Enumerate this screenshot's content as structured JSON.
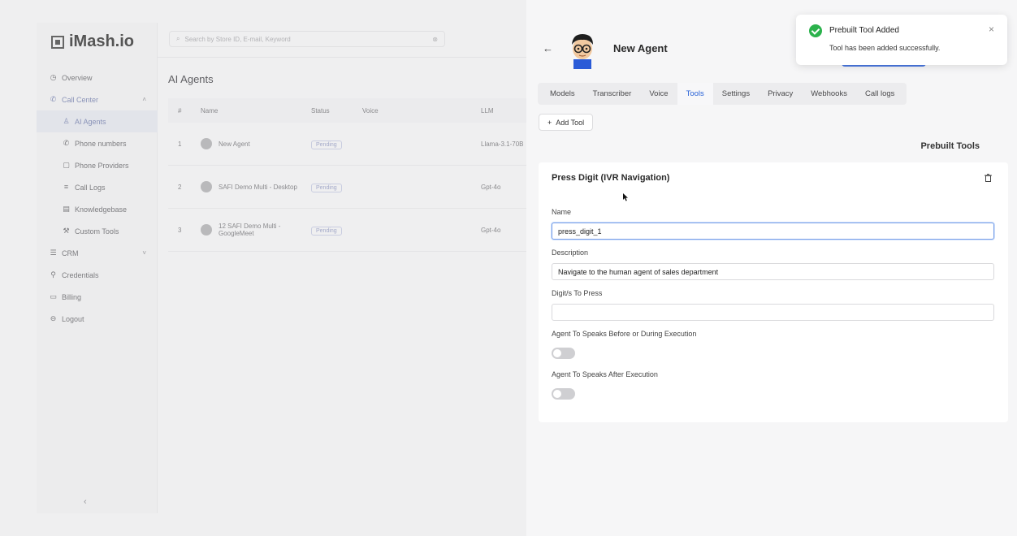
{
  "app": {
    "logo": "iMash.io",
    "search_placeholder": "Search by Store ID, E-mail, Keyword",
    "page_title": "AI Agents",
    "sidebar": [
      {
        "label": "Overview",
        "icon": "clock-icon"
      },
      {
        "label": "Call Center",
        "icon": "phone-icon"
      },
      {
        "label": "AI Agents",
        "icon": "user-icon"
      },
      {
        "label": "Phone numbers",
        "icon": "phone-icon"
      },
      {
        "label": "Phone Providers",
        "icon": "box-icon"
      },
      {
        "label": "Call Logs",
        "icon": "list-icon"
      },
      {
        "label": "Knowledgebase",
        "icon": "doc-icon"
      },
      {
        "label": "Custom Tools",
        "icon": "wrench-icon"
      },
      {
        "label": "CRM",
        "icon": "db-icon"
      },
      {
        "label": "Credentials",
        "icon": "key-icon"
      },
      {
        "label": "Billing",
        "icon": "card-icon"
      },
      {
        "label": "Logout",
        "icon": "logout-icon"
      }
    ],
    "table": {
      "headers": [
        "#",
        "Name",
        "Status",
        "Voice",
        "LLM"
      ],
      "rows": [
        {
          "num": "1",
          "name": "New Agent",
          "status": "Pending",
          "voice": "",
          "llm": "Llama-3.1-70B"
        },
        {
          "num": "2",
          "name": "SAFI Demo Multi - Desktop",
          "status": "Pending",
          "voice": "",
          "llm": "Gpt-4o"
        },
        {
          "num": "3",
          "name": "12 SAFI Demo Multi - GoogleMeet",
          "status": "Pending",
          "voice": "",
          "llm": "Gpt-4o"
        }
      ]
    }
  },
  "drawer": {
    "agent_name": "New Agent",
    "tabs": [
      "Models",
      "Transcriber",
      "Voice",
      "Tools",
      "Settings",
      "Privacy",
      "Webhooks",
      "Call logs"
    ],
    "active_tab": "Tools",
    "add_tool_label": "Add Tool",
    "prebuilt_label": "Prebuilt Tools",
    "card": {
      "title": "Press Digit (IVR Navigation)",
      "name_label": "Name",
      "name_value": "press_digit_1",
      "description_label": "Description",
      "description_value": "Navigate to the human agent of sales department",
      "digits_label": "Digit/s To Press",
      "digits_value": "",
      "speak_before_label": "Agent To Speaks Before or During Execution",
      "speak_before_on": false,
      "speak_after_label": "Agent To Speaks After Execution",
      "speak_after_on": false
    }
  },
  "toast": {
    "title": "Prebuilt Tool Added",
    "message": "Tool has been added successfully."
  },
  "colors": {
    "accent": "#2a63d7",
    "success": "#2bb24c"
  }
}
